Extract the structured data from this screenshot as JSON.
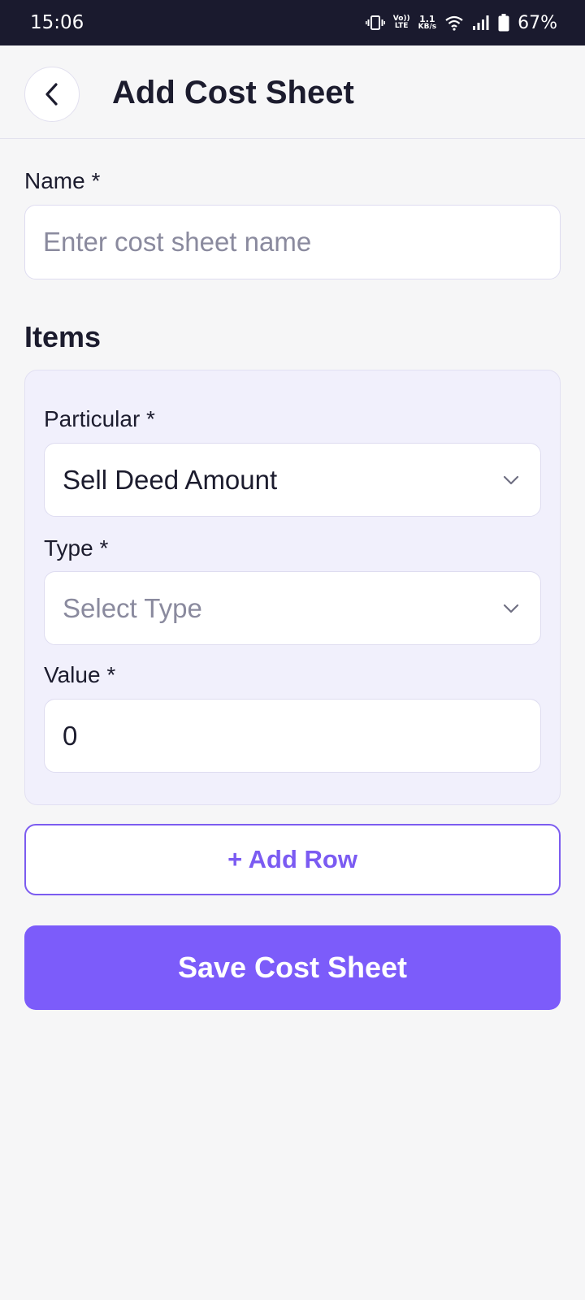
{
  "status_bar": {
    "time": "15:06",
    "volte_top": "Vo))",
    "volte_bottom": "LTE",
    "speed_value": "1.1",
    "speed_unit": "KB/s",
    "battery_percent": "67%"
  },
  "header": {
    "title": "Add Cost Sheet"
  },
  "form": {
    "name_label": "Name *",
    "name_placeholder": "Enter cost sheet name",
    "items_title": "Items",
    "particular_label": "Particular *",
    "particular_value": "Sell Deed Amount",
    "type_label": "Type *",
    "type_placeholder": "Select Type",
    "value_label": "Value *",
    "value_value": "0"
  },
  "actions": {
    "add_row_label": "+ Add Row",
    "save_label": "Save Cost Sheet"
  },
  "colors": {
    "accent": "#7c5cfa",
    "status_bar_bg": "#1a1a2e",
    "card_bg": "#f1f0fc"
  },
  "icons": {
    "back": "chevron-left-icon",
    "dropdown": "chevron-down-icon"
  }
}
